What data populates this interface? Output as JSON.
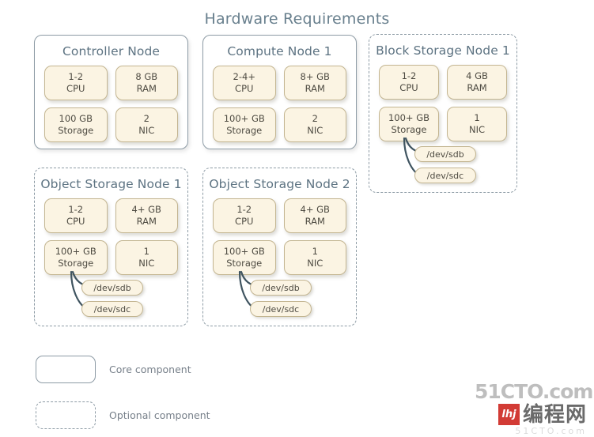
{
  "title": "Hardware Requirements",
  "nodes": [
    {
      "id": "controller-node",
      "title": "Controller Node",
      "type": "core",
      "components": [
        {
          "line1": "1-2",
          "line2": "CPU"
        },
        {
          "line1": "8 GB",
          "line2": "RAM"
        },
        {
          "line1": "100 GB",
          "line2": "Storage"
        },
        {
          "line1": "2",
          "line2": "NIC"
        }
      ],
      "devices": []
    },
    {
      "id": "compute-node-1",
      "title": "Compute Node 1",
      "type": "core",
      "components": [
        {
          "line1": "2-4+",
          "line2": "CPU"
        },
        {
          "line1": "8+ GB",
          "line2": "RAM"
        },
        {
          "line1": "100+ GB",
          "line2": "Storage"
        },
        {
          "line1": "2",
          "line2": "NIC"
        }
      ],
      "devices": []
    },
    {
      "id": "block-storage-node-1",
      "title": "Block Storage Node 1",
      "type": "optional",
      "components": [
        {
          "line1": "1-2",
          "line2": "CPU"
        },
        {
          "line1": "4 GB",
          "line2": "RAM"
        },
        {
          "line1": "100+ GB",
          "line2": "Storage"
        },
        {
          "line1": "1",
          "line2": "NIC"
        }
      ],
      "devices": [
        "/dev/sdb",
        "/dev/sdc"
      ]
    },
    {
      "id": "object-storage-node-1",
      "title": "Object Storage Node 1",
      "type": "optional",
      "components": [
        {
          "line1": "1-2",
          "line2": "CPU"
        },
        {
          "line1": "4+ GB",
          "line2": "RAM"
        },
        {
          "line1": "100+ GB",
          "line2": "Storage"
        },
        {
          "line1": "1",
          "line2": "NIC"
        }
      ],
      "devices": [
        "/dev/sdb",
        "/dev/sdc"
      ]
    },
    {
      "id": "object-storage-node-2",
      "title": "Object Storage Node 2",
      "type": "optional",
      "components": [
        {
          "line1": "1-2",
          "line2": "CPU"
        },
        {
          "line1": "4+ GB",
          "line2": "RAM"
        },
        {
          "line1": "100+ GB",
          "line2": "Storage"
        },
        {
          "line1": "1",
          "line2": "NIC"
        }
      ],
      "devices": [
        "/dev/sdb",
        "/dev/sdc"
      ]
    }
  ],
  "legend": [
    {
      "style": "core",
      "label": "Core component"
    },
    {
      "style": "optional",
      "label": "Optional component"
    }
  ],
  "watermark": {
    "top": "51CTO.com",
    "badge": "lhj",
    "cn": "编程网",
    "ghost": "51CTO.com"
  },
  "colors": {
    "title_text": "#69808e",
    "node_border": "#8d9ba5",
    "component_fill": "#fbf4e3",
    "component_border": "#c3b591",
    "component_text": "#4e4b42",
    "connector": "#3f5460",
    "legend_text": "#77808a",
    "watermark_red": "#cf2b24"
  }
}
